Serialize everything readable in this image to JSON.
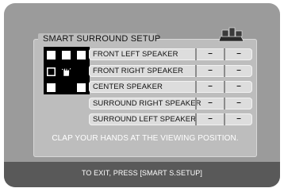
{
  "title": "SMART SURROUND SETUP",
  "speakers": [
    {
      "label": "FRONT LEFT SPEAKER",
      "value1": "–",
      "value2": "–"
    },
    {
      "label": "FRONT RIGHT SPEAKER",
      "value1": "–",
      "value2": "–"
    },
    {
      "label": "CENTER SPEAKER",
      "value1": "–",
      "value2": "–"
    },
    {
      "label": "SURROUND RIGHT SPEAKER",
      "value1": "–",
      "value2": "–"
    },
    {
      "label": "SURROUND LEFT SPEAKER",
      "value1": "–",
      "value2": "–"
    }
  ],
  "instruction": "CLAP YOUR HANDS AT THE VIEWING POSITION.",
  "footer": "TO EXIT, PRESS [SMART S.SETUP]",
  "icons": {
    "tv": "tv-speaker-icon",
    "hands": "clapping-hands-icon"
  }
}
